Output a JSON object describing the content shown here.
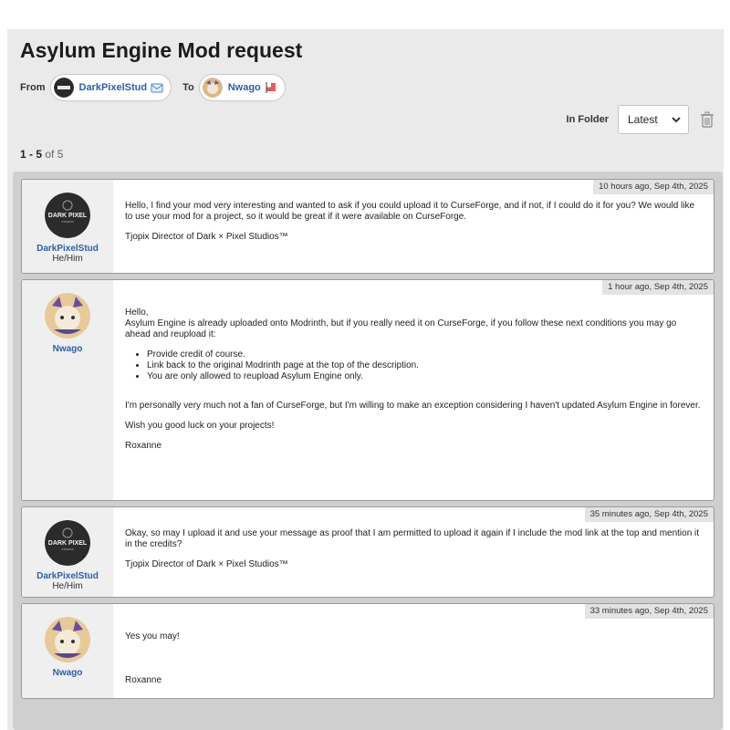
{
  "conversation": {
    "title": "Asylum Engine Mod request",
    "from_label": "From",
    "from_user": "DarkPixelStud",
    "to_label": "To",
    "to_user": "Nwago"
  },
  "toolbar": {
    "folder_label": "In Folder",
    "folder_selected": "Latest"
  },
  "pagination": {
    "range": "1 - 5",
    "of_text": "of 5"
  },
  "messages": [
    {
      "author": "DarkPixelStud",
      "pronouns": "He/Him",
      "timestamp": "10 hours ago, Sep 4th, 2025",
      "paragraphs": [
        "Hello, I find your mod very interesting and wanted to ask if you could upload it to CurseForge, and if not, if I could do it for you? We would like to use your mod for a project, so it would be great if it were available on CurseForge.",
        "Tjopix Director of Dark × Pixel Studios™"
      ]
    },
    {
      "author": "Nwago",
      "timestamp": "1 hour ago, Sep 4th, 2025",
      "intro": "Hello,",
      "p1": "Asylum Engine is already uploaded onto Modrinth, but if you really need it on CurseForge, if you follow these next conditions you may go ahead and reupload it:",
      "list": [
        "Provide credit of course.",
        "Link back to the original Modrinth page at the top of the description.",
        "You are only allowed to reupload Asylum Engine only."
      ],
      "p2": "I'm personally very much not a fan of CurseForge, but I'm willing to make an exception considering I haven't updated Asylum Engine in forever.",
      "p3": "Wish you good luck on your projects!",
      "sign": "Roxanne"
    },
    {
      "author": "DarkPixelStud",
      "pronouns": "He/Him",
      "timestamp": "35 minutes ago, Sep 4th, 2025",
      "paragraphs": [
        "Okay, so may I upload it and use your message as proof that I am permitted to upload it again if I include the mod link at the top and mention it in the credits?",
        "Tjopix Director of Dark × Pixel Studios™"
      ]
    },
    {
      "author": "Nwago",
      "timestamp": "33 minutes ago, Sep 4th, 2025",
      "paragraphs": [
        "Yes you may!",
        "Roxanne"
      ]
    }
  ],
  "icons": {
    "from_badge": "envelope-icon",
    "to_badge": "flag-icon",
    "folder_chevron": "chevron-down-icon",
    "delete": "trash-icon"
  },
  "colors": {
    "link": "#2e5ea8",
    "panel": "#eaeaea",
    "thread_bg": "#cfcfcf"
  }
}
